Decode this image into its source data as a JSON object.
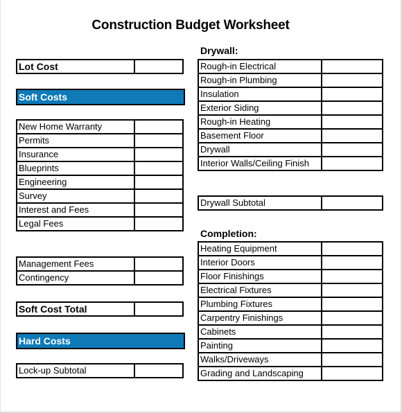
{
  "title": "Construction Budget Worksheet",
  "colors": {
    "section_bar": "#0f7ab8",
    "border": "#000000"
  },
  "left": {
    "lot_cost": {
      "label": "Lot Cost",
      "value": ""
    },
    "soft_costs_header": "Soft Costs",
    "soft_items": [
      {
        "label": "New Home Warranty",
        "value": ""
      },
      {
        "label": "Permits",
        "value": ""
      },
      {
        "label": "Insurance",
        "value": ""
      },
      {
        "label": "Blueprints",
        "value": ""
      },
      {
        "label": "Engineering",
        "value": ""
      },
      {
        "label": "Survey",
        "value": ""
      },
      {
        "label": "Interest and Fees",
        "value": ""
      },
      {
        "label": "Legal Fees",
        "value": ""
      }
    ],
    "other_items": [
      {
        "label": "Management Fees",
        "value": ""
      },
      {
        "label": "Contingency",
        "value": ""
      }
    ],
    "soft_cost_total": {
      "label": "Soft Cost Total",
      "value": ""
    },
    "hard_costs_header": "Hard Costs",
    "lockup_subtotal": {
      "label": "Lock-up Subtotal",
      "value": ""
    }
  },
  "right": {
    "drywall_heading": "Drywall:",
    "drywall_items": [
      {
        "label": "Rough-in Electrical",
        "value": ""
      },
      {
        "label": "Rough-in Plumbing",
        "value": ""
      },
      {
        "label": "Insulation",
        "value": ""
      },
      {
        "label": "Exterior Siding",
        "value": ""
      },
      {
        "label": "Rough-in Heating",
        "value": ""
      },
      {
        "label": "Basement Floor",
        "value": ""
      },
      {
        "label": "Drywall",
        "value": ""
      },
      {
        "label": "Interior Walls/Ceiling Finish",
        "value": ""
      }
    ],
    "drywall_subtotal": {
      "label": "Drywall Subtotal",
      "value": ""
    },
    "completion_heading": "Completion:",
    "completion_items": [
      {
        "label": "Heating Equipment",
        "value": ""
      },
      {
        "label": "Interior Doors",
        "value": ""
      },
      {
        "label": "Floor Finishings",
        "value": ""
      },
      {
        "label": "Electrical Fixtures",
        "value": ""
      },
      {
        "label": "Plumbing Fixtures",
        "value": ""
      },
      {
        "label": "Carpentry Finishings",
        "value": ""
      },
      {
        "label": "Cabinets",
        "value": ""
      },
      {
        "label": "Painting",
        "value": ""
      },
      {
        "label": "Walks/Driveways",
        "value": ""
      },
      {
        "label": "Grading and Landscaping",
        "value": ""
      }
    ]
  }
}
